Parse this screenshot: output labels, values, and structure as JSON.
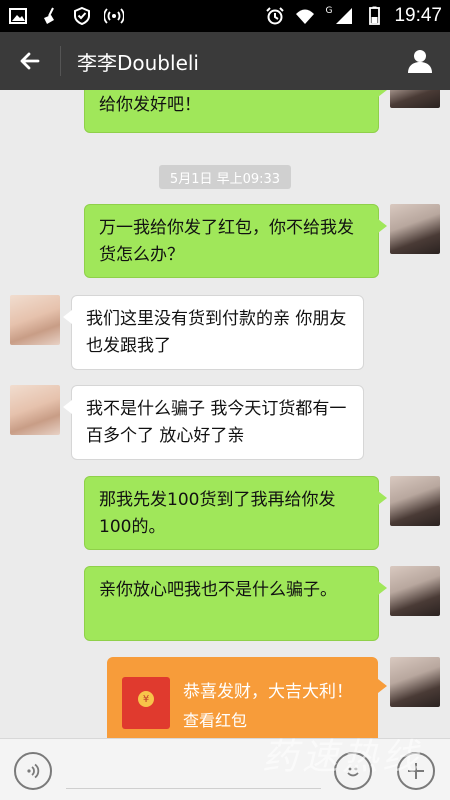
{
  "status_bar": {
    "time": "19:47",
    "network_label": "G"
  },
  "header": {
    "title": "李李Doubleli"
  },
  "messages": [
    {
      "side": "self",
      "text": "给你发好吧！"
    },
    {
      "timestamp": "5月1日 早上09:33"
    },
    {
      "side": "self",
      "text": "万一我给你发了红包，你不给我发货怎么办？"
    },
    {
      "side": "other",
      "text": "我们这里没有货到付款的亲  你朋友也发跟我了"
    },
    {
      "side": "other",
      "text": "我不是什么骗子 我今天订货都有一百多个了 放心好了亲"
    },
    {
      "side": "self",
      "text": "那我先发100货到了我再给你发100的。"
    },
    {
      "side": "self",
      "text": "亲你放心吧我也不是什么骗子。"
    },
    {
      "side": "self",
      "type": "red_packet",
      "title": "恭喜发财，大吉大利！",
      "subtitle": "查看红包",
      "coin_symbol": "¥"
    }
  ],
  "watermark": "药速热线",
  "colors": {
    "self_bubble": "#a0e75a",
    "other_bubble": "#ffffff",
    "red_packet": "#f79c3a",
    "header_bg": "#3a3a3a"
  },
  "icons": {
    "back": "arrow-left-icon",
    "profile": "person-icon",
    "voice": "voice-icon",
    "emoji": "emoji-icon",
    "plus": "plus-icon"
  }
}
